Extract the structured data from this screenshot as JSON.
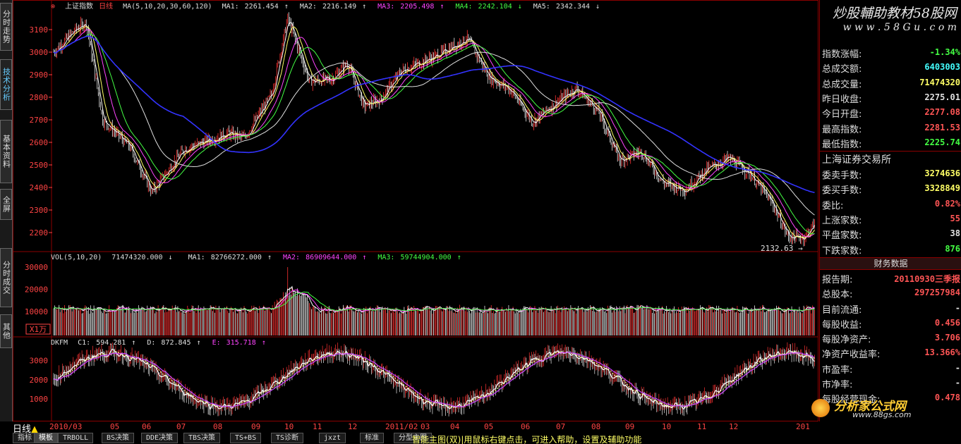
{
  "watermark": {
    "title": "炒股輔助教材58股网",
    "url": "w w w . 5 8 G u . c o m"
  },
  "left_tabs": [
    {
      "label": "分时走势",
      "active": false
    },
    {
      "label": "技术分析",
      "active": true
    },
    {
      "label": "基本资料",
      "active": false
    },
    {
      "label": "全屏",
      "active": false
    },
    {
      "label": "分时成交",
      "active": false
    },
    {
      "label": "其他",
      "active": false
    }
  ],
  "main_legend": {
    "title": "上证指数",
    "period": "日线",
    "ma_label": "MA(5,10,20,30,60,120)",
    "items": [
      {
        "label": "MA1:",
        "value": "2261.454",
        "arrow": "↑",
        "color": "#e0e0e0"
      },
      {
        "label": "MA2:",
        "value": "2216.149",
        "arrow": "↑",
        "color": "#e0e0e0"
      },
      {
        "label": "MA3:",
        "value": "2205.498",
        "arrow": "↑",
        "color": "#ff44ff"
      },
      {
        "label": "MA4:",
        "value": "2242.104",
        "arrow": "↓",
        "color": "#44ff44"
      },
      {
        "label": "MA5:",
        "value": "2342.344",
        "arrow": "↓",
        "color": "#e0e0e0"
      }
    ]
  },
  "price_axis": [
    "3100",
    "3000",
    "2900",
    "2800",
    "2700",
    "2600",
    "2500",
    "2400",
    "2300",
    "2200"
  ],
  "low_label": "2132.63",
  "vol_legend": {
    "label": "VOL(5,10,20)",
    "value": "71474320.000",
    "arrow": "↓",
    "items": [
      {
        "label": "MA1:",
        "value": "82766272.000",
        "arrow": "↑",
        "color": "#e0e0e0"
      },
      {
        "label": "MA2:",
        "value": "86909644.000",
        "arrow": "↑",
        "color": "#ff44ff"
      },
      {
        "label": "MA3:",
        "value": "59744904.000",
        "arrow": "↑",
        "color": "#44ff44"
      }
    ]
  },
  "vol_axis": [
    "30000",
    "20000",
    "10000"
  ],
  "vol_unit": "X1万",
  "dkfm_legend": {
    "label": "DKFM",
    "items": [
      {
        "label": "C1:",
        "value": "594.281",
        "arrow": "↑",
        "color": "#e0e0e0"
      },
      {
        "label": "D:",
        "value": "872.845",
        "arrow": "↑",
        "color": "#e0e0e0"
      },
      {
        "label": "E:",
        "value": "315.718",
        "arrow": "↑",
        "color": "#ff44ff"
      }
    ]
  },
  "dkfm_axis": [
    "3000",
    "2000",
    "1000"
  ],
  "date_axis": [
    "2010/03",
    "05",
    "06",
    "07",
    "08",
    "09",
    "10",
    "11",
    "12",
    "2011/02",
    "03",
    "04",
    "05",
    "06",
    "07",
    "08",
    "09",
    "10",
    "11",
    "12",
    "201"
  ],
  "index_stats": [
    {
      "label": "指数涨幅:",
      "value": "-1.34%",
      "color": "#44ff44"
    },
    {
      "label": "总成交额:",
      "value": "6403003",
      "color": "#44ffff"
    },
    {
      "label": "总成交量:",
      "value": "71474320",
      "color": "#ffff66"
    },
    {
      "label": "昨日收盘:",
      "value": "2275.01",
      "color": "#e0e0e0"
    },
    {
      "label": "今日开盘:",
      "value": "2277.08",
      "color": "#ff5555"
    },
    {
      "label": "最高指数:",
      "value": "2281.53",
      "color": "#ff5555"
    },
    {
      "label": "最低指数:",
      "value": "2225.74",
      "color": "#44ff44"
    }
  ],
  "exchange": {
    "name": "上海证券交易所",
    "rows": [
      {
        "label": "委卖手数:",
        "value": "3274636",
        "color": "#ffff66"
      },
      {
        "label": "委买手数:",
        "value": "3328849",
        "color": "#ffff66"
      },
      {
        "label": "委比:",
        "value": "0.82%",
        "color": "#ff5555"
      },
      {
        "label": "上涨家数:",
        "value": "55",
        "color": "#ff5555"
      },
      {
        "label": "平盘家数:",
        "value": "38",
        "color": "#e0e0e0"
      },
      {
        "label": "下跌家数:",
        "value": "876",
        "color": "#44ff44"
      }
    ]
  },
  "finance": {
    "header": "财务数据",
    "rows": [
      {
        "label": "报告期:",
        "value": "20110930三季报",
        "color": "#ff5555"
      },
      {
        "label": "总股本:",
        "value": "297257984",
        "color": "#ff5555"
      },
      {
        "label": "目前流通:",
        "value": "-",
        "color": "#e0e0e0"
      },
      {
        "label": "每股收益:",
        "value": "0.456",
        "color": "#ff5555"
      },
      {
        "label": "每股净资产:",
        "value": "3.706",
        "color": "#ff5555"
      },
      {
        "label": "净资产收益率:",
        "value": "13.366%",
        "color": "#ff5555"
      },
      {
        "label": "市盈率:",
        "value": "-",
        "color": "#e0e0e0"
      },
      {
        "label": "市净率:",
        "value": "-",
        "color": "#e0e0e0"
      },
      {
        "label": "每股经营现金:",
        "value": "0.478",
        "color": "#ff5555"
      }
    ]
  },
  "logo": {
    "text": "分析家公式网",
    "url": "www.88gs.com"
  },
  "period_indicator": "日线",
  "bottom_tabs": [
    {
      "label": "指标",
      "active": false
    },
    {
      "label": "模板",
      "active": true
    },
    {
      "label": "TRBOLL",
      "active": false
    },
    {
      "label": "BS决策",
      "active": false
    },
    {
      "label": "DDE决策",
      "active": false
    },
    {
      "label": "TBS决策",
      "active": false
    },
    {
      "label": "TS+BS",
      "active": false
    },
    {
      "label": "TS诊断",
      "active": false
    },
    {
      "label": "jxzt",
      "active": false
    },
    {
      "label": "标准",
      "active": false
    },
    {
      "label": "分型主图",
      "active": false
    }
  ],
  "status_text": "智能主图(双)|用鼠标右键点击，可进入帮助，设置及辅助功能",
  "colors": {
    "grid_border": "#8b0000",
    "up_candle": "#ff3333",
    "down_candle": "#e8e8e8",
    "ma_blue": "#3333ff"
  }
}
